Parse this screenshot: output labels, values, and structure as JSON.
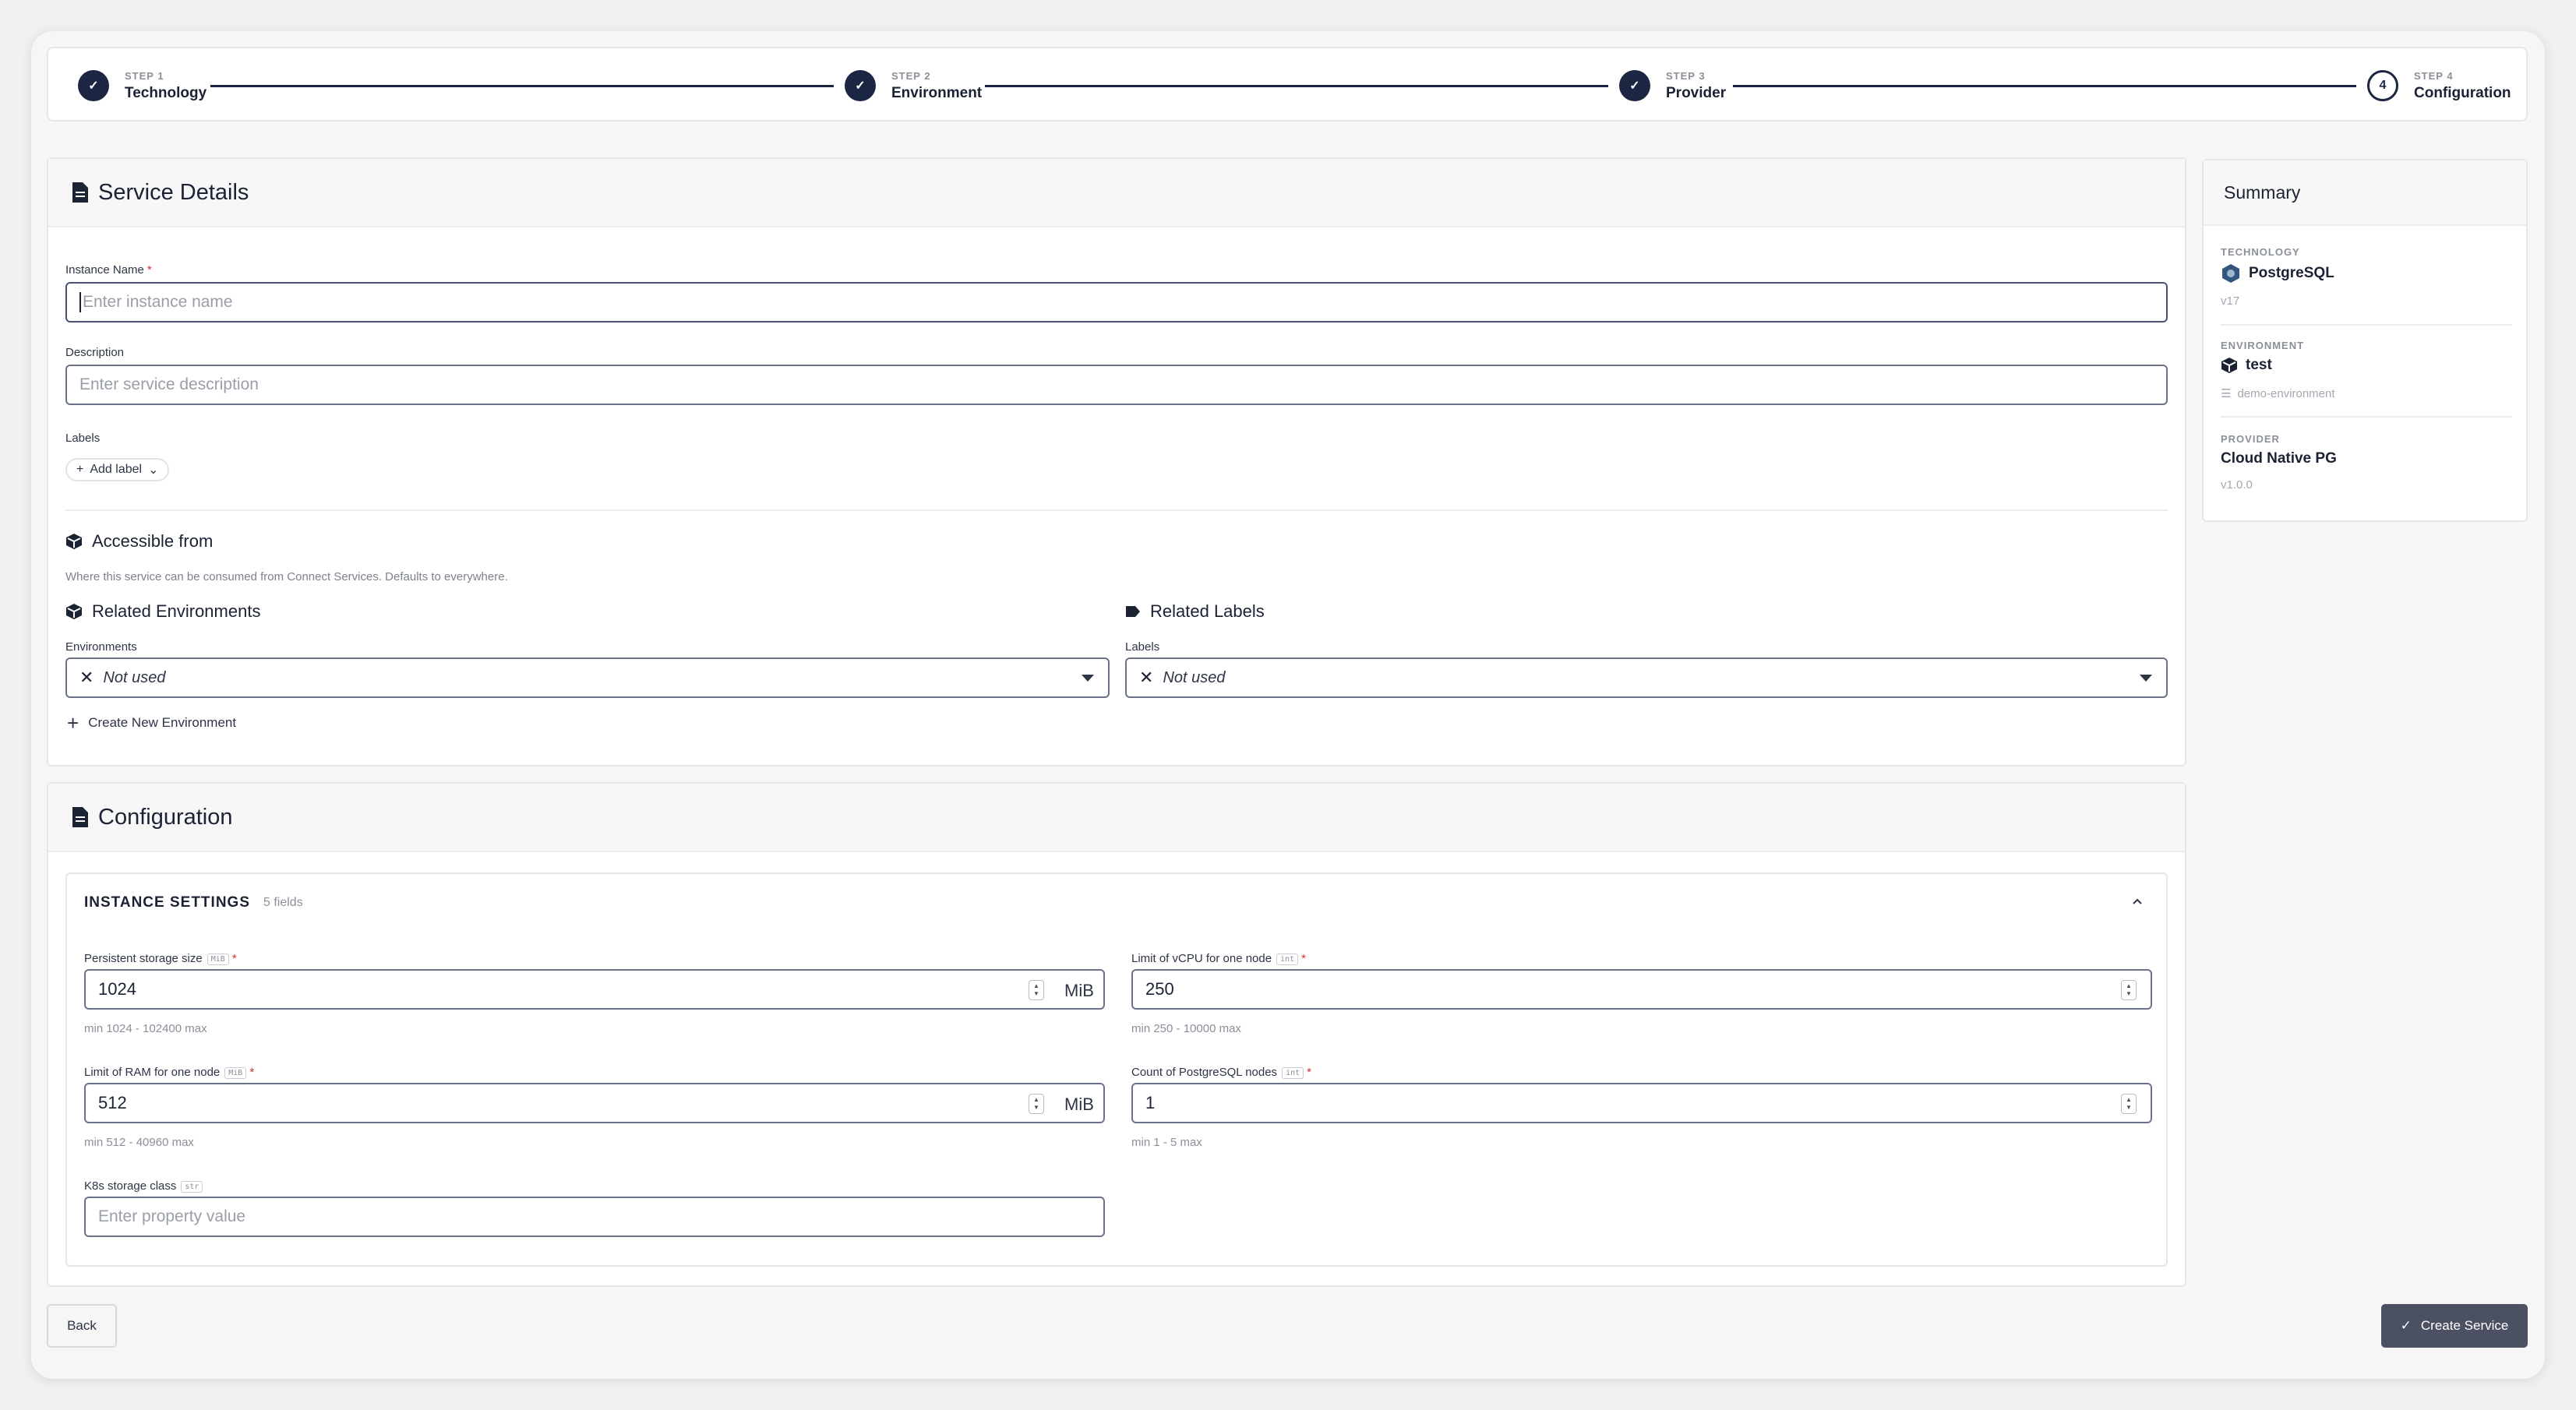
{
  "stepper": {
    "steps": [
      {
        "num": "STEP 1",
        "name": "Technology",
        "marker": "✓"
      },
      {
        "num": "STEP 2",
        "name": "Environment",
        "marker": "✓"
      },
      {
        "num": "STEP 3",
        "name": "Provider",
        "marker": "✓"
      },
      {
        "num": "STEP 4",
        "name": "Configuration",
        "marker": "4"
      }
    ]
  },
  "service_details": {
    "title": "Service Details",
    "instance_name": {
      "label": "Instance Name",
      "required": "*",
      "placeholder": "Enter instance name"
    },
    "description": {
      "label": "Description",
      "placeholder": "Enter service description"
    },
    "labels": {
      "label": "Labels",
      "add_button": "Add label"
    },
    "accessible_from": {
      "title": "Accessible from",
      "hint": "Where this service can be consumed from Connect Services. Defaults to everywhere.",
      "related_environments": {
        "title": "Related Environments",
        "field_label": "Environments",
        "value": "Not used",
        "create_link": "Create New Environment"
      },
      "related_labels": {
        "title": "Related Labels",
        "field_label": "Labels",
        "value": "Not used"
      }
    }
  },
  "configuration": {
    "title": "Configuration",
    "group": {
      "title": "INSTANCE SETTINGS",
      "count": "5 fields"
    },
    "fields": {
      "storage": {
        "label": "Persistent storage size",
        "tag": "MiB",
        "required": "*",
        "value": "1024",
        "unit": "MiB",
        "range": "min 1024 - 102400 max"
      },
      "vcpu": {
        "label": "Limit of vCPU for one node",
        "tag": "int",
        "required": "*",
        "value": "250",
        "range": "min 250 - 10000 max"
      },
      "ram": {
        "label": "Limit of RAM for one node",
        "tag": "MiB",
        "required": "*",
        "value": "512",
        "unit": "MiB",
        "range": "min 512 - 40960 max"
      },
      "nodes": {
        "label": "Count of PostgreSQL nodes",
        "tag": "int",
        "required": "*",
        "value": "1",
        "range": "min 1 - 5 max"
      },
      "storage_class": {
        "label": "K8s storage class",
        "tag": "str",
        "placeholder": "Enter property value"
      }
    }
  },
  "summary": {
    "title": "Summary",
    "technology": {
      "caption": "TECHNOLOGY",
      "value": "PostgreSQL",
      "sub": "v17"
    },
    "environment": {
      "caption": "ENVIRONMENT",
      "value": "test",
      "sub": "demo-environment"
    },
    "provider": {
      "caption": "PROVIDER",
      "value": "Cloud Native PG",
      "sub": "v1.0.0"
    }
  },
  "footer": {
    "back": "Back",
    "create": "Create Service"
  },
  "colors": {
    "primary": "#1c2541",
    "button": "#4b5063",
    "required": "#d32f2f"
  }
}
